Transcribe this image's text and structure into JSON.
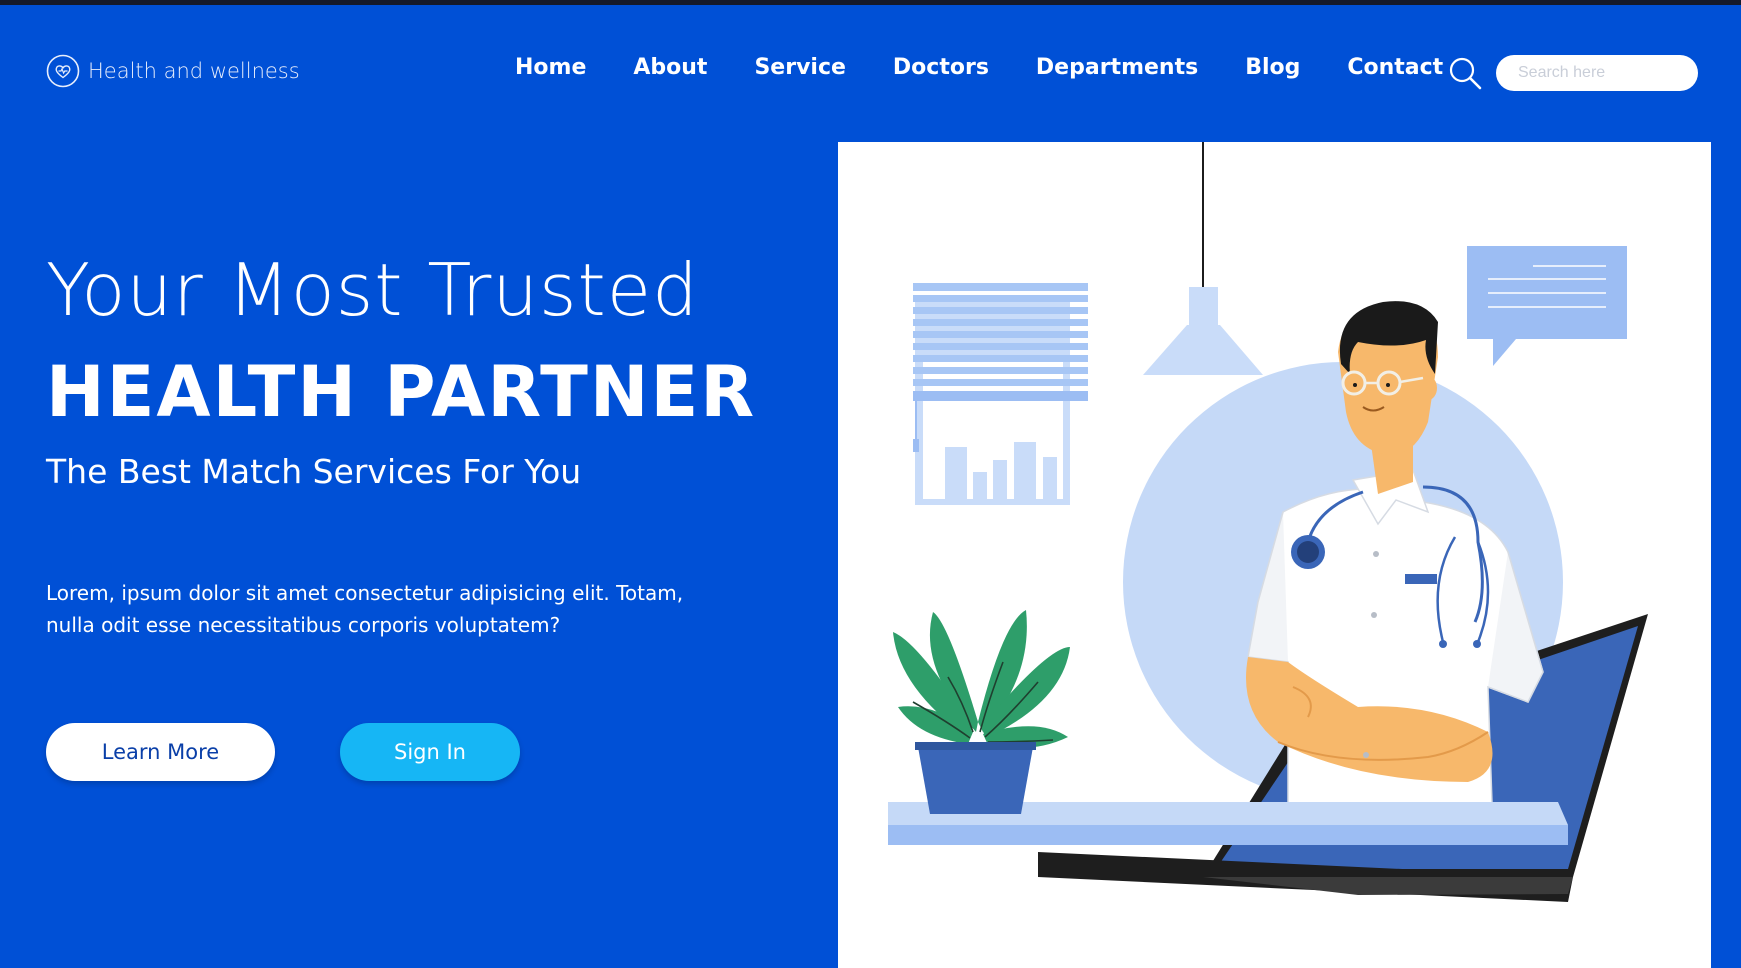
{
  "header": {
    "brand": {
      "name": "Health and wellness",
      "icon": "heart-icon"
    },
    "nav": [
      {
        "label": "Home"
      },
      {
        "label": "About"
      },
      {
        "label": "Service"
      },
      {
        "label": "Doctors"
      },
      {
        "label": "Departments"
      },
      {
        "label": "Blog"
      },
      {
        "label": "Contact"
      }
    ],
    "search": {
      "placeholder": "Search here",
      "value": "",
      "icon": "search-icon"
    }
  },
  "hero": {
    "title_line1": "Your Most Trusted",
    "title_line2": "HEALTH PARTNER",
    "subtitle": "The Best Match Services For You",
    "text": "Lorem, ipsum dolor sit amet consectetur adipisicing elit. Totam, nulla odit esse necessitatibus corporis voluptatem?",
    "learn_more_label": "Learn More",
    "sign_in_label": "Sign In"
  },
  "illustration": {
    "subject": "doctor-illustration"
  },
  "colors": {
    "background": "#0050d6",
    "accent": "#16b6f5",
    "panel": "#ffffff",
    "light_blue": "#c5d9f7"
  }
}
